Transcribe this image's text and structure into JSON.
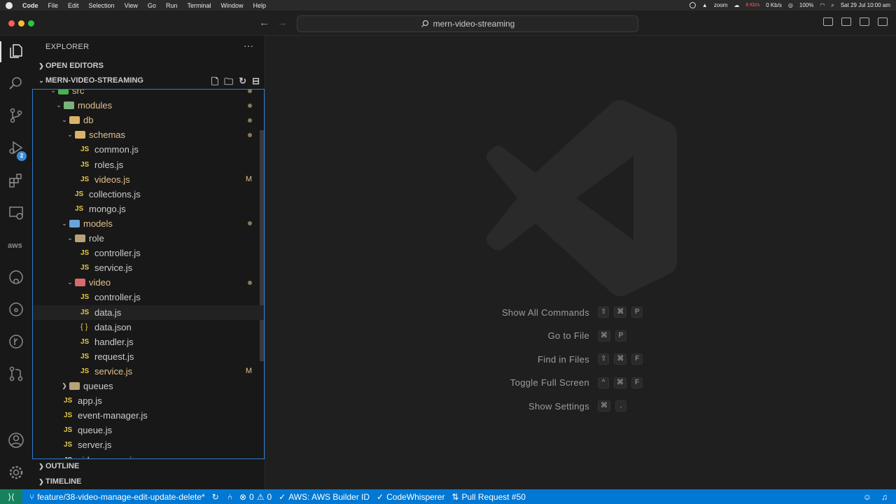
{
  "menubar": {
    "app": "Code",
    "items": [
      "File",
      "Edit",
      "Selection",
      "View",
      "Go",
      "Run",
      "Terminal",
      "Window",
      "Help"
    ],
    "zoom": "zoom",
    "net_up": "8 Kb/s",
    "net_down": "0 Kb/s",
    "battery": "100%",
    "datetime": "Sat 29 Jul  10:00 am"
  },
  "titlebar": {
    "search": "mern-video-streaming"
  },
  "activity": {
    "scm_badge": "2",
    "aws_label": "aws"
  },
  "sidebar": {
    "title": "EXPLORER",
    "more": "···",
    "open_editors": "OPEN EDITORS",
    "project": "MERN-VIDEO-STREAMING",
    "outline": "OUTLINE",
    "timeline": "TIMELINE",
    "tree": [
      {
        "name": "src",
        "type": "folder",
        "depth": 0,
        "open": true,
        "dot": true
      },
      {
        "name": "modules",
        "type": "folder",
        "depth": 1,
        "open": true,
        "dot": true
      },
      {
        "name": "db",
        "type": "folder",
        "depth": 2,
        "open": true,
        "dot": true
      },
      {
        "name": "schemas",
        "type": "folder",
        "depth": 3,
        "open": true,
        "dot": true
      },
      {
        "name": "common.js",
        "type": "js",
        "depth": 4
      },
      {
        "name": "roles.js",
        "type": "js",
        "depth": 4
      },
      {
        "name": "videos.js",
        "type": "js",
        "depth": 4,
        "mark": "M"
      },
      {
        "name": "collections.js",
        "type": "js",
        "depth": 3
      },
      {
        "name": "mongo.js",
        "type": "js",
        "depth": 3
      },
      {
        "name": "models",
        "type": "folder",
        "depth": 2,
        "open": true,
        "dot": true
      },
      {
        "name": "role",
        "type": "folder",
        "depth": 3,
        "open": true
      },
      {
        "name": "controller.js",
        "type": "js",
        "depth": 4
      },
      {
        "name": "service.js",
        "type": "js",
        "depth": 4
      },
      {
        "name": "video",
        "type": "folder",
        "depth": 3,
        "open": true,
        "dot": true
      },
      {
        "name": "controller.js",
        "type": "js",
        "depth": 4
      },
      {
        "name": "data.js",
        "type": "js",
        "depth": 4,
        "hover": true
      },
      {
        "name": "data.json",
        "type": "json",
        "depth": 4
      },
      {
        "name": "handler.js",
        "type": "js",
        "depth": 4
      },
      {
        "name": "request.js",
        "type": "js",
        "depth": 4
      },
      {
        "name": "service.js",
        "type": "js",
        "depth": 4,
        "mark": "M"
      },
      {
        "name": "queues",
        "type": "folder",
        "depth": 2,
        "open": false
      },
      {
        "name": "app.js",
        "type": "js",
        "depth": 1
      },
      {
        "name": "event-manager.js",
        "type": "js",
        "depth": 1
      },
      {
        "name": "queue.js",
        "type": "js",
        "depth": 1
      },
      {
        "name": "server.js",
        "type": "js",
        "depth": 1
      },
      {
        "name": "video-server.js",
        "type": "js",
        "depth": 1
      }
    ]
  },
  "editor": {
    "shortcuts": [
      {
        "label": "Show All Commands",
        "keys": [
          "⇧",
          "⌘",
          "P"
        ]
      },
      {
        "label": "Go to File",
        "keys": [
          "⌘",
          "P"
        ]
      },
      {
        "label": "Find in Files",
        "keys": [
          "⇧",
          "⌘",
          "F"
        ]
      },
      {
        "label": "Toggle Full Screen",
        "keys": [
          "^",
          "⌘",
          "F"
        ]
      },
      {
        "label": "Show Settings",
        "keys": [
          "⌘",
          ","
        ]
      }
    ]
  },
  "statusbar": {
    "branch": "feature/38-video-manage-edit-update-delete*",
    "errors": "0",
    "warnings": "0",
    "aws": "AWS: AWS Builder ID",
    "codewhisperer": "CodeWhisperer",
    "pr": "Pull Request #50"
  },
  "colors": {
    "accent": "#0078d4",
    "remote": "#16825d",
    "modified": "#e2c08d",
    "js_icon": "#e6c84a"
  }
}
